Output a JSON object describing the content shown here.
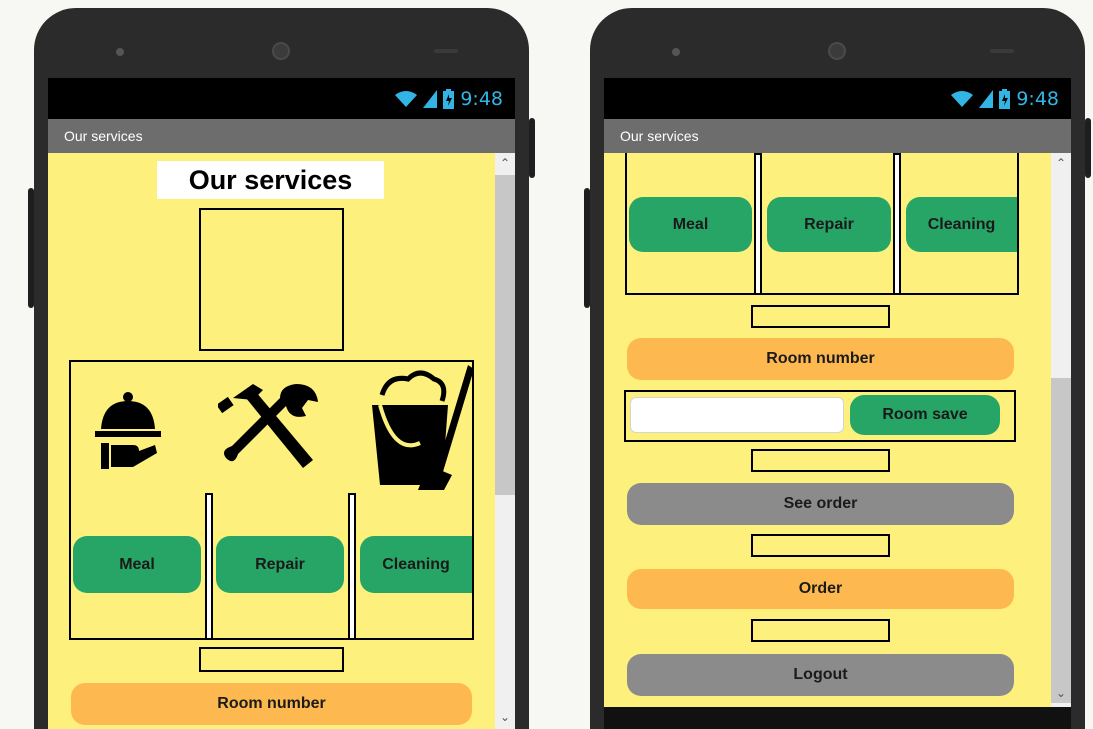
{
  "left_screen": {
    "status_time": "9:48",
    "title_bar": "Our services",
    "page_title": "Our services",
    "service_icons": [
      "meal-icon",
      "repair-tools-icon",
      "cleaning-bucket-icon"
    ],
    "services": [
      {
        "label": "Meal"
      },
      {
        "label": "Repair"
      },
      {
        "label": "Cleaning"
      }
    ],
    "room_number_label": "Room number"
  },
  "right_screen": {
    "status_time": "9:48",
    "title_bar": "Our services",
    "services": [
      {
        "label": "Meal"
      },
      {
        "label": "Repair"
      },
      {
        "label": "Cleaning"
      }
    ],
    "room_number_label": "Room number",
    "room_input": {
      "value": "",
      "placeholder": ""
    },
    "room_save_label": "Room save",
    "see_order_label": "See order",
    "order_label": "Order",
    "logout_label": "Logout"
  },
  "colors": {
    "background": "#fdf07c",
    "green_button": "#27a566",
    "orange_button": "#fdb94f",
    "gray_button": "#8b8b8b",
    "status_text": "#32b5e5",
    "title_bar": "#6d6d6d"
  }
}
